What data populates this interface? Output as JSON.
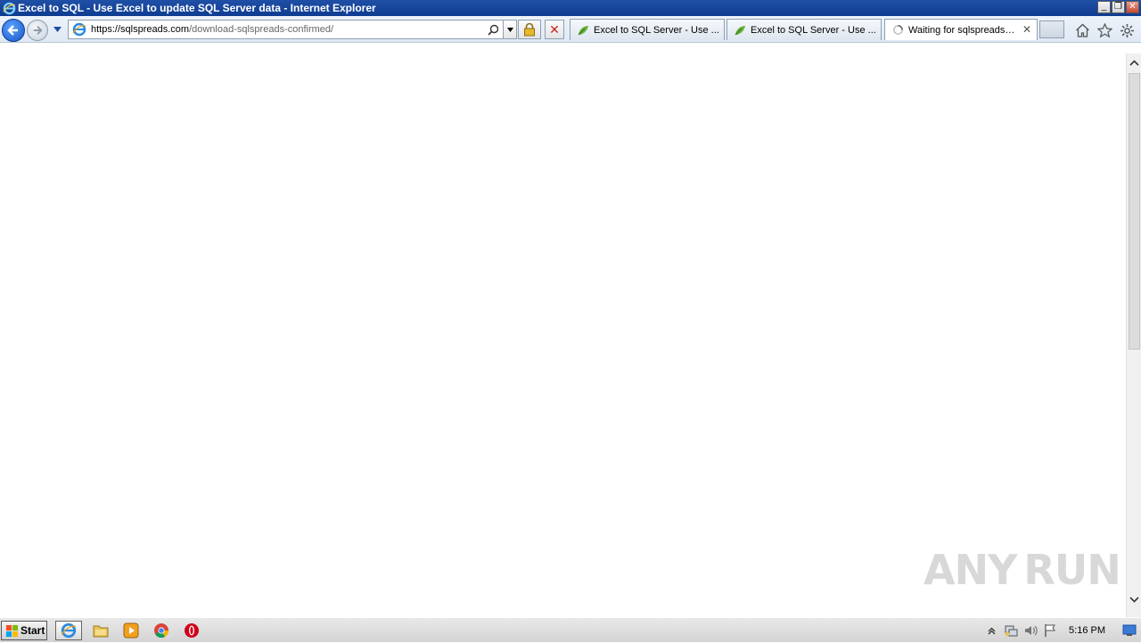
{
  "window": {
    "title": "Excel to SQL - Use Excel to update SQL Server data - Internet Explorer",
    "controls": {
      "minimize": "_",
      "restore": "❐",
      "close": "✕"
    }
  },
  "address": {
    "url_host": "https://sqlspreads.com",
    "url_path": "/download-sqlspreads-confirmed/"
  },
  "tabs": [
    {
      "label": "Excel to SQL Server - Use ...",
      "icon": "sqlspreads-leaf-icon",
      "active": false
    },
    {
      "label": "Excel to SQL Server - Use ...",
      "icon": "sqlspreads-leaf-icon",
      "active": false
    },
    {
      "label": "Waiting for sqlspreads.com...",
      "icon": "loading-spinner-icon",
      "active": true,
      "close": "✕"
    }
  ],
  "watermark": {
    "text_left": "ANY",
    "text_right": "RUN"
  },
  "taskbar": {
    "start_label": "Start",
    "clock": "5:16 PM"
  },
  "colors": {
    "titlebar": "#1f4fa6",
    "accent": "#1958c7"
  }
}
